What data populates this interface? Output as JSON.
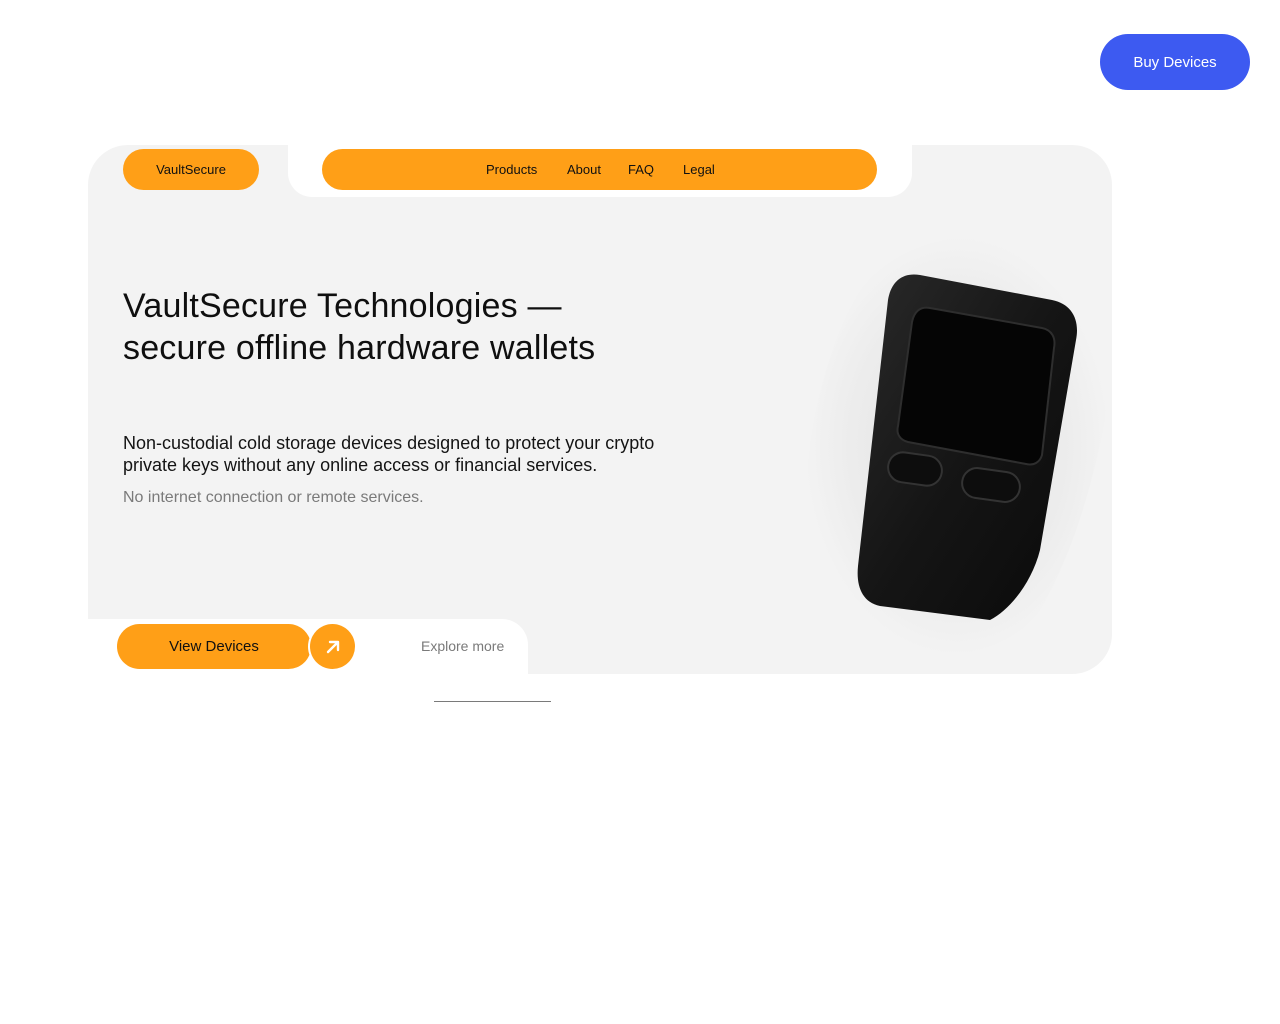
{
  "header": {
    "buy_label": "Buy Devices"
  },
  "nav": {
    "brand": "VaultSecure",
    "links": [
      {
        "label": "Products"
      },
      {
        "label": "About"
      },
      {
        "label": "FAQ"
      },
      {
        "label": "Legal"
      }
    ]
  },
  "hero": {
    "headline_line1": "VaultSecure Technologies —",
    "headline_line2": "secure offline hardware wallets",
    "lede_line1": "Non-custodial cold storage devices designed to protect your crypto",
    "lede_line2": "private keys without any online access or financial services.",
    "note": "No internet connection or remote services.",
    "cta_label": "View Devices",
    "explore_label": "Explore more"
  },
  "icons": {
    "cta_arrow": "arrow-up-right-icon"
  },
  "colors": {
    "accent": "#ff9f17",
    "primary_button": "#3d5af1",
    "card_background": "#f3f3f3",
    "muted_text": "#7a7a7a"
  }
}
